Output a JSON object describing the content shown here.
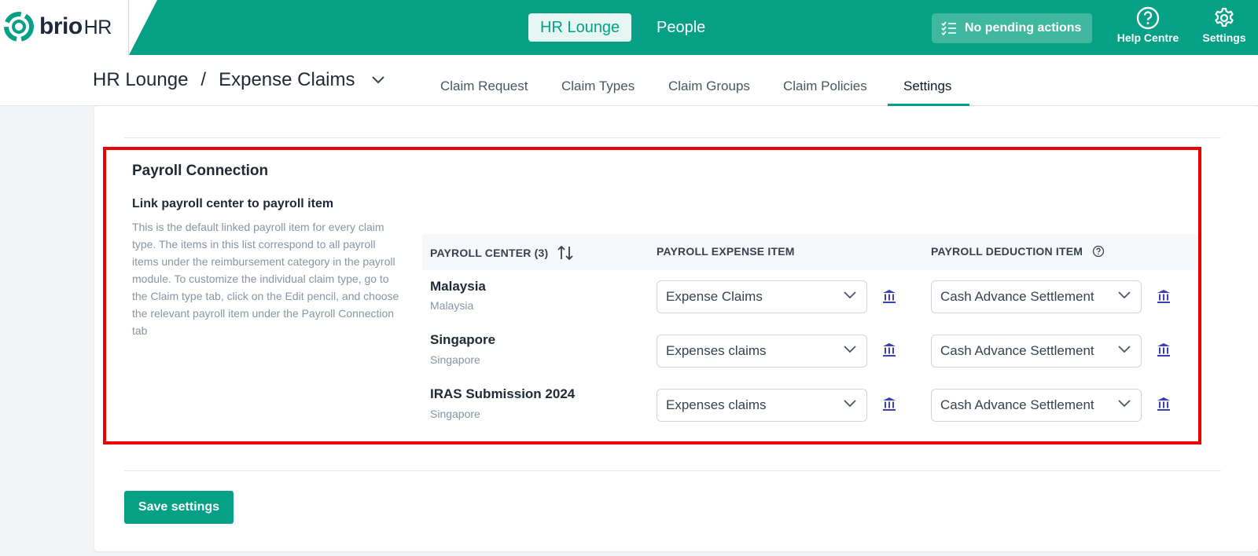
{
  "header": {
    "logo_text": "brio",
    "logo_suffix": "HR",
    "nav": [
      "HR Lounge",
      "People"
    ],
    "pending_label": "No pending actions",
    "help_label": "Help Centre",
    "settings_label": "Settings",
    "brand_color": "#05a085"
  },
  "subheader": {
    "breadcrumb_root": "HR Lounge",
    "breadcrumb_sep": "/",
    "breadcrumb_current": "Expense Claims",
    "tabs": [
      "Claim Request",
      "Claim Types",
      "Claim Groups",
      "Claim Policies",
      "Settings"
    ],
    "active_tab": "Settings"
  },
  "section": {
    "title": "Payroll Connection",
    "subtitle": "Link payroll center to payroll item",
    "description": "This is the default linked payroll item for every claim type. The items in this list correspond to all payroll items under the reimbursement category in the payroll module. To customize the individual claim type, go to the Claim type tab, click on the Edit pencil, and choose the relevant payroll item under the Payroll Connection tab"
  },
  "table": {
    "headers": [
      "PAYROLL CENTER (3)",
      "PAYROLL EXPENSE ITEM",
      "PAYROLL DEDUCTION ITEM"
    ],
    "rows": [
      {
        "center": "Malaysia",
        "country": "Malaysia",
        "expense": "Expense Claims",
        "deduction": "Cash Advance Settlement"
      },
      {
        "center": "Singapore",
        "country": "Singapore",
        "expense": "Expenses claims",
        "deduction": "Cash Advance Settlement"
      },
      {
        "center": "IRAS Submission 2024",
        "country": "Singapore",
        "expense": "Expenses claims",
        "deduction": "Cash Advance Settlement"
      }
    ]
  },
  "actions": {
    "save_label": "Save settings"
  },
  "colors": {
    "highlight": "#ef0000",
    "link_icon": "#3b3fb6"
  }
}
